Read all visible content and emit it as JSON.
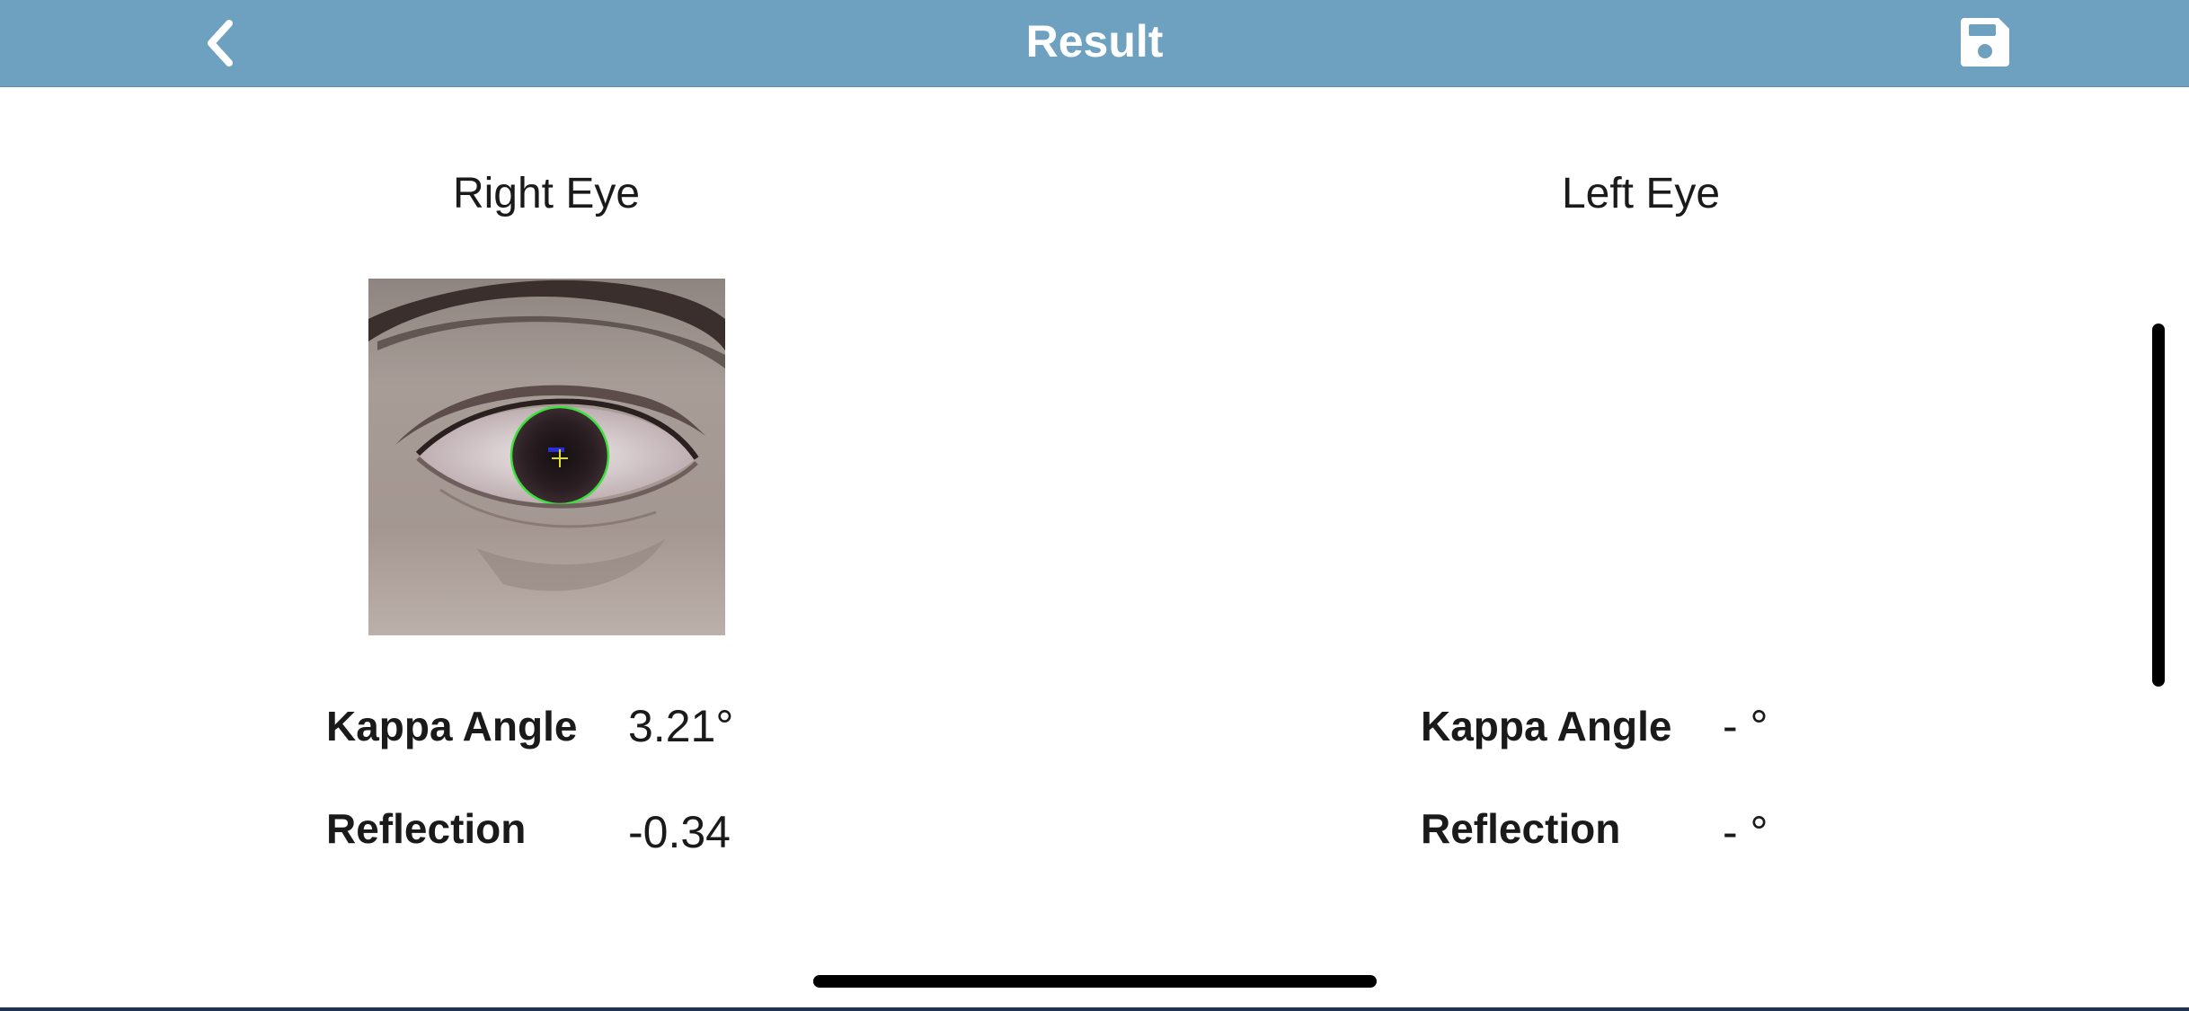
{
  "header": {
    "title": "Result",
    "back_icon": "chevron-left-icon",
    "save_icon": "floppy-disk-icon",
    "bar_color": "#6da1bf"
  },
  "right_eye": {
    "heading": "Right Eye",
    "kappa_label": "Kappa Angle",
    "kappa_value": "3.21°",
    "reflection_label": "Reflection",
    "reflection_value": "-0.34"
  },
  "left_eye": {
    "heading": "Left Eye",
    "kappa_label": "Kappa Angle",
    "kappa_value": "- °",
    "reflection_label": "Reflection",
    "reflection_value": "- °"
  }
}
